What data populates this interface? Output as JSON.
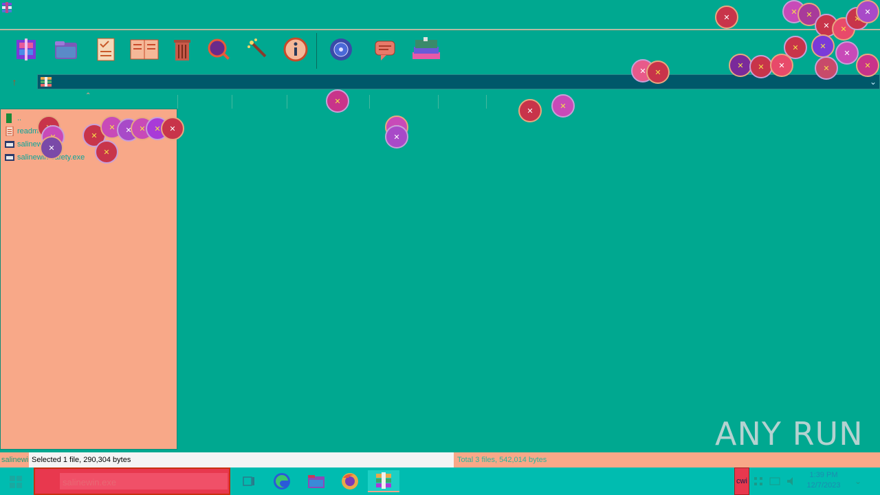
{
  "window": {
    "address_path": ""
  },
  "toolbar": {
    "buttons": [
      {
        "name": "add-button"
      },
      {
        "name": "extract-button"
      },
      {
        "name": "test-button"
      },
      {
        "name": "view-button"
      },
      {
        "name": "delete-button"
      },
      {
        "name": "find-button"
      },
      {
        "name": "wizard-button"
      },
      {
        "name": "info-button"
      },
      {
        "name": "virusscan-button"
      },
      {
        "name": "comment-button"
      },
      {
        "name": "sfx-button"
      }
    ]
  },
  "left_pane": {
    "items": [
      {
        "label": "..",
        "icon": "folder-up-icon"
      },
      {
        "label": "readme.txt",
        "icon": "text-file-icon"
      },
      {
        "label": "salinewin.exe",
        "icon": "exe-file-icon"
      },
      {
        "label": "salinewin-safety.exe",
        "icon": "exe-file-icon"
      }
    ]
  },
  "statusbar": {
    "left": "salinewin.exe",
    "selected": "Selected 1 file, 290,304 bytes",
    "total": "Total 3 files, 542,014 bytes"
  },
  "taskbar": {
    "search_placeholder": "salinewin.exe",
    "tray_label": "cwi",
    "clock_time": "1:39 PM",
    "clock_date": "12/7/2023"
  },
  "watermark": "ANY RUN",
  "colors": {
    "background": "#00a890",
    "left_pane": "#f8a888",
    "taskbar": "#00bcb0",
    "error_icon": "#c8344a"
  }
}
